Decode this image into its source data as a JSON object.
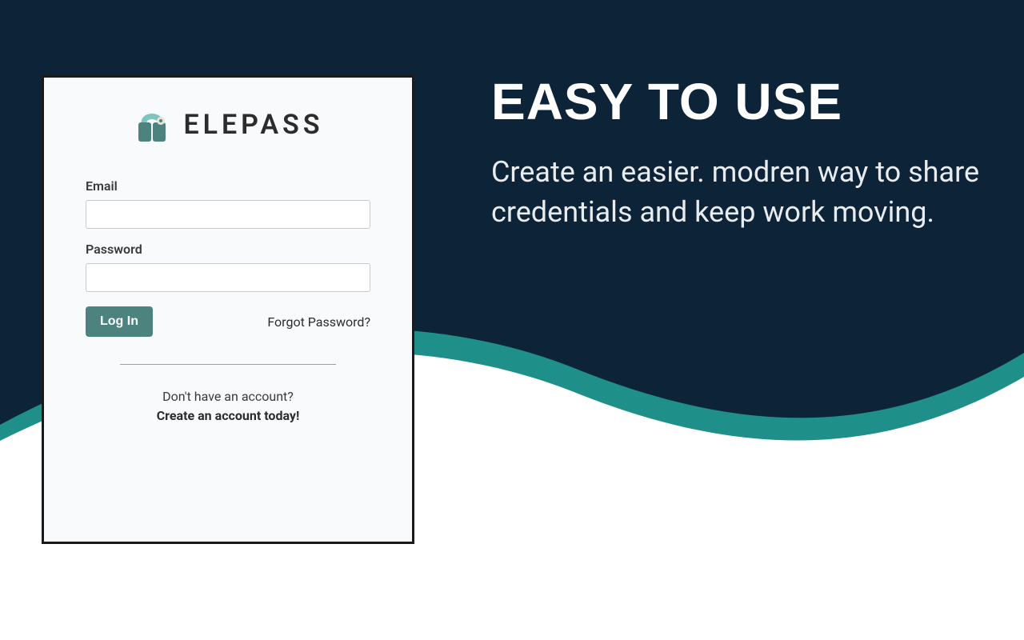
{
  "brand": {
    "name": "ELEPASS"
  },
  "login": {
    "email_label": "Email",
    "email_value": "",
    "password_label": "Password",
    "password_value": "",
    "submit_label": "Log In",
    "forgot_label": "Forgot Password?",
    "signup_prompt": "Don't have an account?",
    "signup_cta": "Create an account today!"
  },
  "hero": {
    "title": "EASY TO USE",
    "subtitle": "Create an easier. modren way to share credentials and keep work moving."
  },
  "colors": {
    "bg_dark": "#0d2438",
    "accent": "#1f8f8a",
    "button": "#4c837e"
  }
}
